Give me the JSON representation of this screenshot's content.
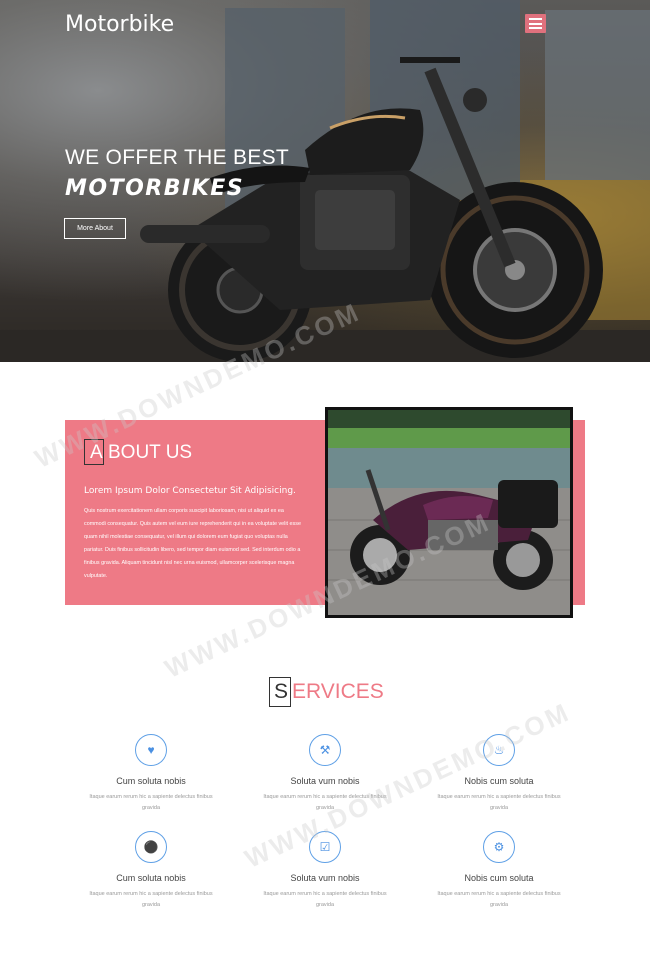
{
  "header": {
    "brand": "Motorbike"
  },
  "hero": {
    "line1": "WE OFFER THE BEST",
    "line2": "MOTORBIKES",
    "button_label": "More About"
  },
  "about": {
    "title_first": "A",
    "title_rest": "BOUT US",
    "subtitle": "Lorem Ipsum Dolor Consectetur Sit Adipisicing.",
    "body": "Quis nostrum exercitationem ullam corporis suscipit laboriosam, nisi ut aliquid ex ea commodi consequatur. Quis autem vel eum iure reprehenderit qui in ea voluptate velit esse quam nihil molestiae consequatur, vel illum qui dolorem eum fugiat quo voluptas nulla pariatur. Duis finibus sollicitudin libero, sed tempor diam euismod sed. Sed interdum odio a finibus gravida. Aliquam tincidunt nisl nec urna euismod, ullamcorper scelerisque magna vulputate."
  },
  "services": {
    "title_first": "S",
    "title_rest": "ERVICES",
    "items": [
      {
        "icon": "heart-icon",
        "title": "Cum soluta nobis",
        "desc": "Itaque earum rerum hic a sapiente delectus finibus gravida"
      },
      {
        "icon": "wrench-icon",
        "title": "Soluta vum nobis",
        "desc": "Itaque earum rerum hic a sapiente delectus finibus gravida"
      },
      {
        "icon": "bell-icon",
        "title": "Nobis cum soluta",
        "desc": "Itaque earum rerum hic a sapiente delectus finibus gravida"
      },
      {
        "icon": "motorcycle-icon",
        "title": "Cum soluta nobis",
        "desc": "Itaque earum rerum hic a sapiente delectus finibus gravida"
      },
      {
        "icon": "checkbox-icon",
        "title": "Soluta vum nobis",
        "desc": "Itaque earum rerum hic a sapiente delectus finibus gravida"
      },
      {
        "icon": "gears-icon",
        "title": "Nobis cum soluta",
        "desc": "Itaque earum rerum hic a sapiente delectus finibus gravida"
      }
    ]
  },
  "colors": {
    "accent": "#ee7a86",
    "icon_blue": "#4a90e2"
  },
  "watermark": "WWW.DOWNDEMO.COM"
}
